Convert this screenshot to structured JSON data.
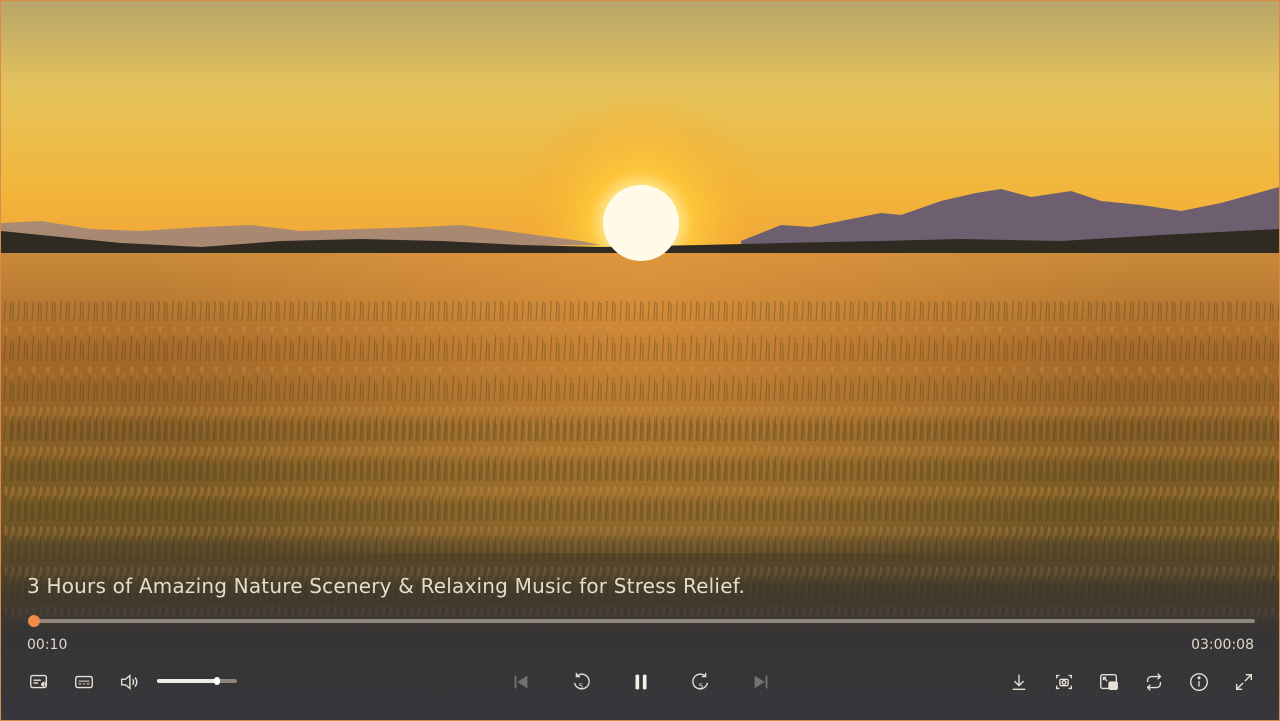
{
  "video": {
    "title": "3 Hours of Amazing Nature Scenery & Relaxing Music for Stress Relief.",
    "current_time": "00:10",
    "duration": "03:00:08",
    "progress_fraction": 0.0009,
    "volume_fraction": 0.75,
    "state": "playing"
  },
  "controls": {
    "left": [
      {
        "name": "audio-description-icon"
      },
      {
        "name": "subtitles-icon"
      },
      {
        "name": "volume-icon"
      }
    ],
    "center": [
      {
        "name": "previous-icon",
        "enabled": false
      },
      {
        "name": "rewind-5-icon",
        "seconds": "5"
      },
      {
        "name": "pause-icon"
      },
      {
        "name": "forward-5-icon",
        "seconds": "5"
      },
      {
        "name": "next-icon",
        "enabled": false
      }
    ],
    "right": [
      {
        "name": "download-icon"
      },
      {
        "name": "screenshot-icon"
      },
      {
        "name": "picture-in-picture-icon"
      },
      {
        "name": "loop-icon"
      },
      {
        "name": "info-icon"
      },
      {
        "name": "fullscreen-icon"
      }
    ]
  },
  "colors": {
    "accent": "#f08a4b",
    "control_icon": "#e8e0d2",
    "frame_border": "#d98a4a"
  }
}
